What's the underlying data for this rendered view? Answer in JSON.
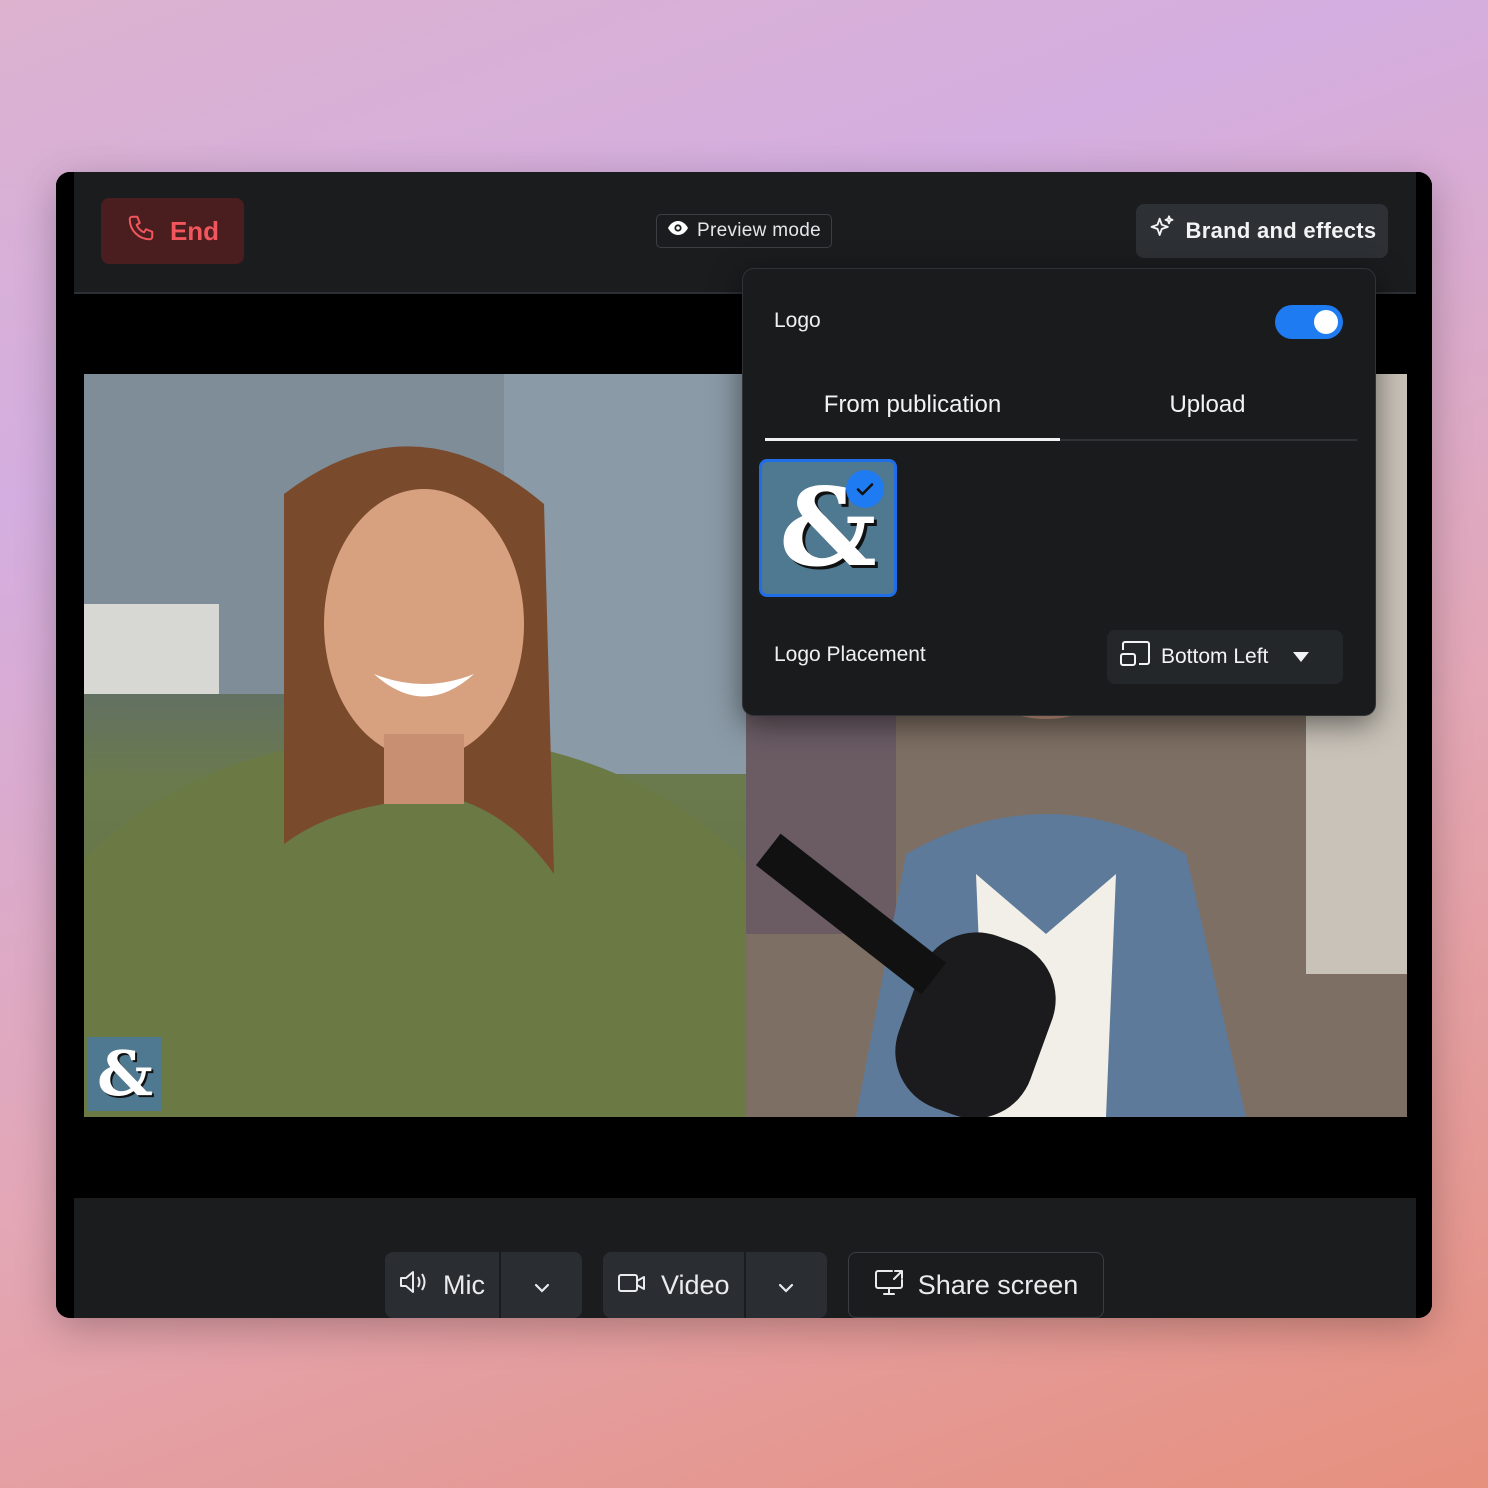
{
  "topbar": {
    "end_label": "End",
    "preview_label": "Preview mode",
    "brand_label": "Brand and effects"
  },
  "brand_panel": {
    "logo_label": "Logo",
    "logo_enabled": true,
    "tabs": [
      {
        "label": "From publication",
        "active": true
      },
      {
        "label": "Upload",
        "active": false
      }
    ],
    "selected_logo_glyph": "&",
    "placement_label": "Logo Placement",
    "placement_value": "Bottom Left"
  },
  "participants": [
    {
      "tile": "left",
      "logo_glyph": "&"
    },
    {
      "tile": "right"
    }
  ],
  "controls": {
    "mic_label": "Mic",
    "video_label": "Video",
    "share_label": "Share screen"
  },
  "colors": {
    "accent": "#1f7bf2",
    "end_red": "#f0565c",
    "logo_bg": "#4f7891"
  }
}
